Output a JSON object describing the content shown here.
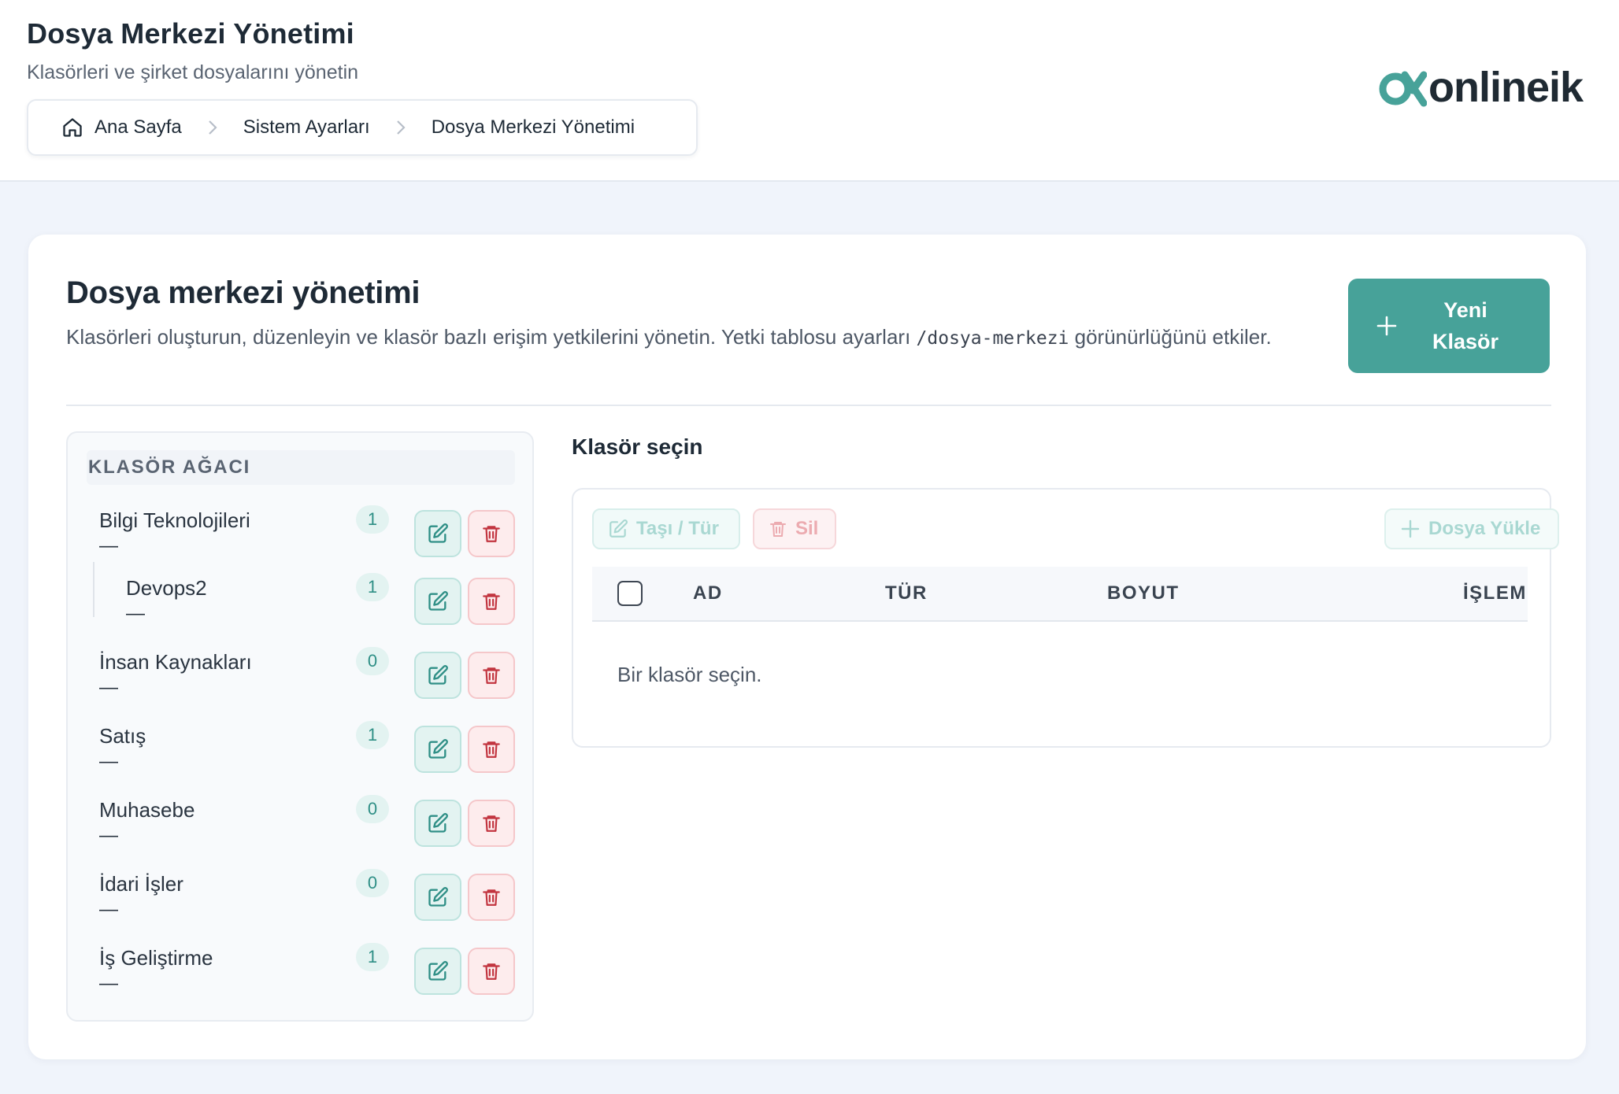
{
  "header": {
    "title": "Dosya Merkezi Yönetimi",
    "subtitle": "Klasörleri ve şirket dosyalarını yönetin",
    "breadcrumb": [
      "Ana Sayfa",
      "Sistem Ayarları",
      "Dosya Merkezi Yönetimi"
    ],
    "logo_text": "onlineik"
  },
  "card": {
    "title": "Dosya merkezi yönetimi",
    "desc_before": "Klasörleri oluşturun, düzenleyin ve klasör bazlı erişim yetkilerini yönetin. Yetki tablosu ayarları ",
    "desc_code": "/dosya-merkezi",
    "desc_after": " görünürlüğünü etkiler.",
    "new_folder_line1": "Yeni",
    "new_folder_line2": "Klasör"
  },
  "tree": {
    "heading": "KLASÖR AĞACI",
    "items": [
      {
        "name": "Bilgi Teknolojileri",
        "dash": "—",
        "count": "1"
      },
      {
        "name": "Devops2",
        "dash": "—",
        "count": "1"
      },
      {
        "name": "İnsan Kaynakları",
        "dash": "—",
        "count": "0"
      },
      {
        "name": "Satış",
        "dash": "—",
        "count": "1"
      },
      {
        "name": "Muhasebe",
        "dash": "—",
        "count": "0"
      },
      {
        "name": "İdari İşler",
        "dash": "—",
        "count": "0"
      },
      {
        "name": "İş Geliştirme",
        "dash": "—",
        "count": "1"
      }
    ]
  },
  "files": {
    "title": "Klasör seçin",
    "move_label": "Taşı / Tür",
    "delete_label": "Sil",
    "upload_label": "Dosya Yükle",
    "columns": [
      "AD",
      "TÜR",
      "BOYUT",
      "İŞLEM"
    ],
    "empty": "Bir klasör seçin."
  },
  "colors": {
    "accent": "#47a299",
    "danger": "#c2343f",
    "page_bg": "#f0f4fb"
  }
}
